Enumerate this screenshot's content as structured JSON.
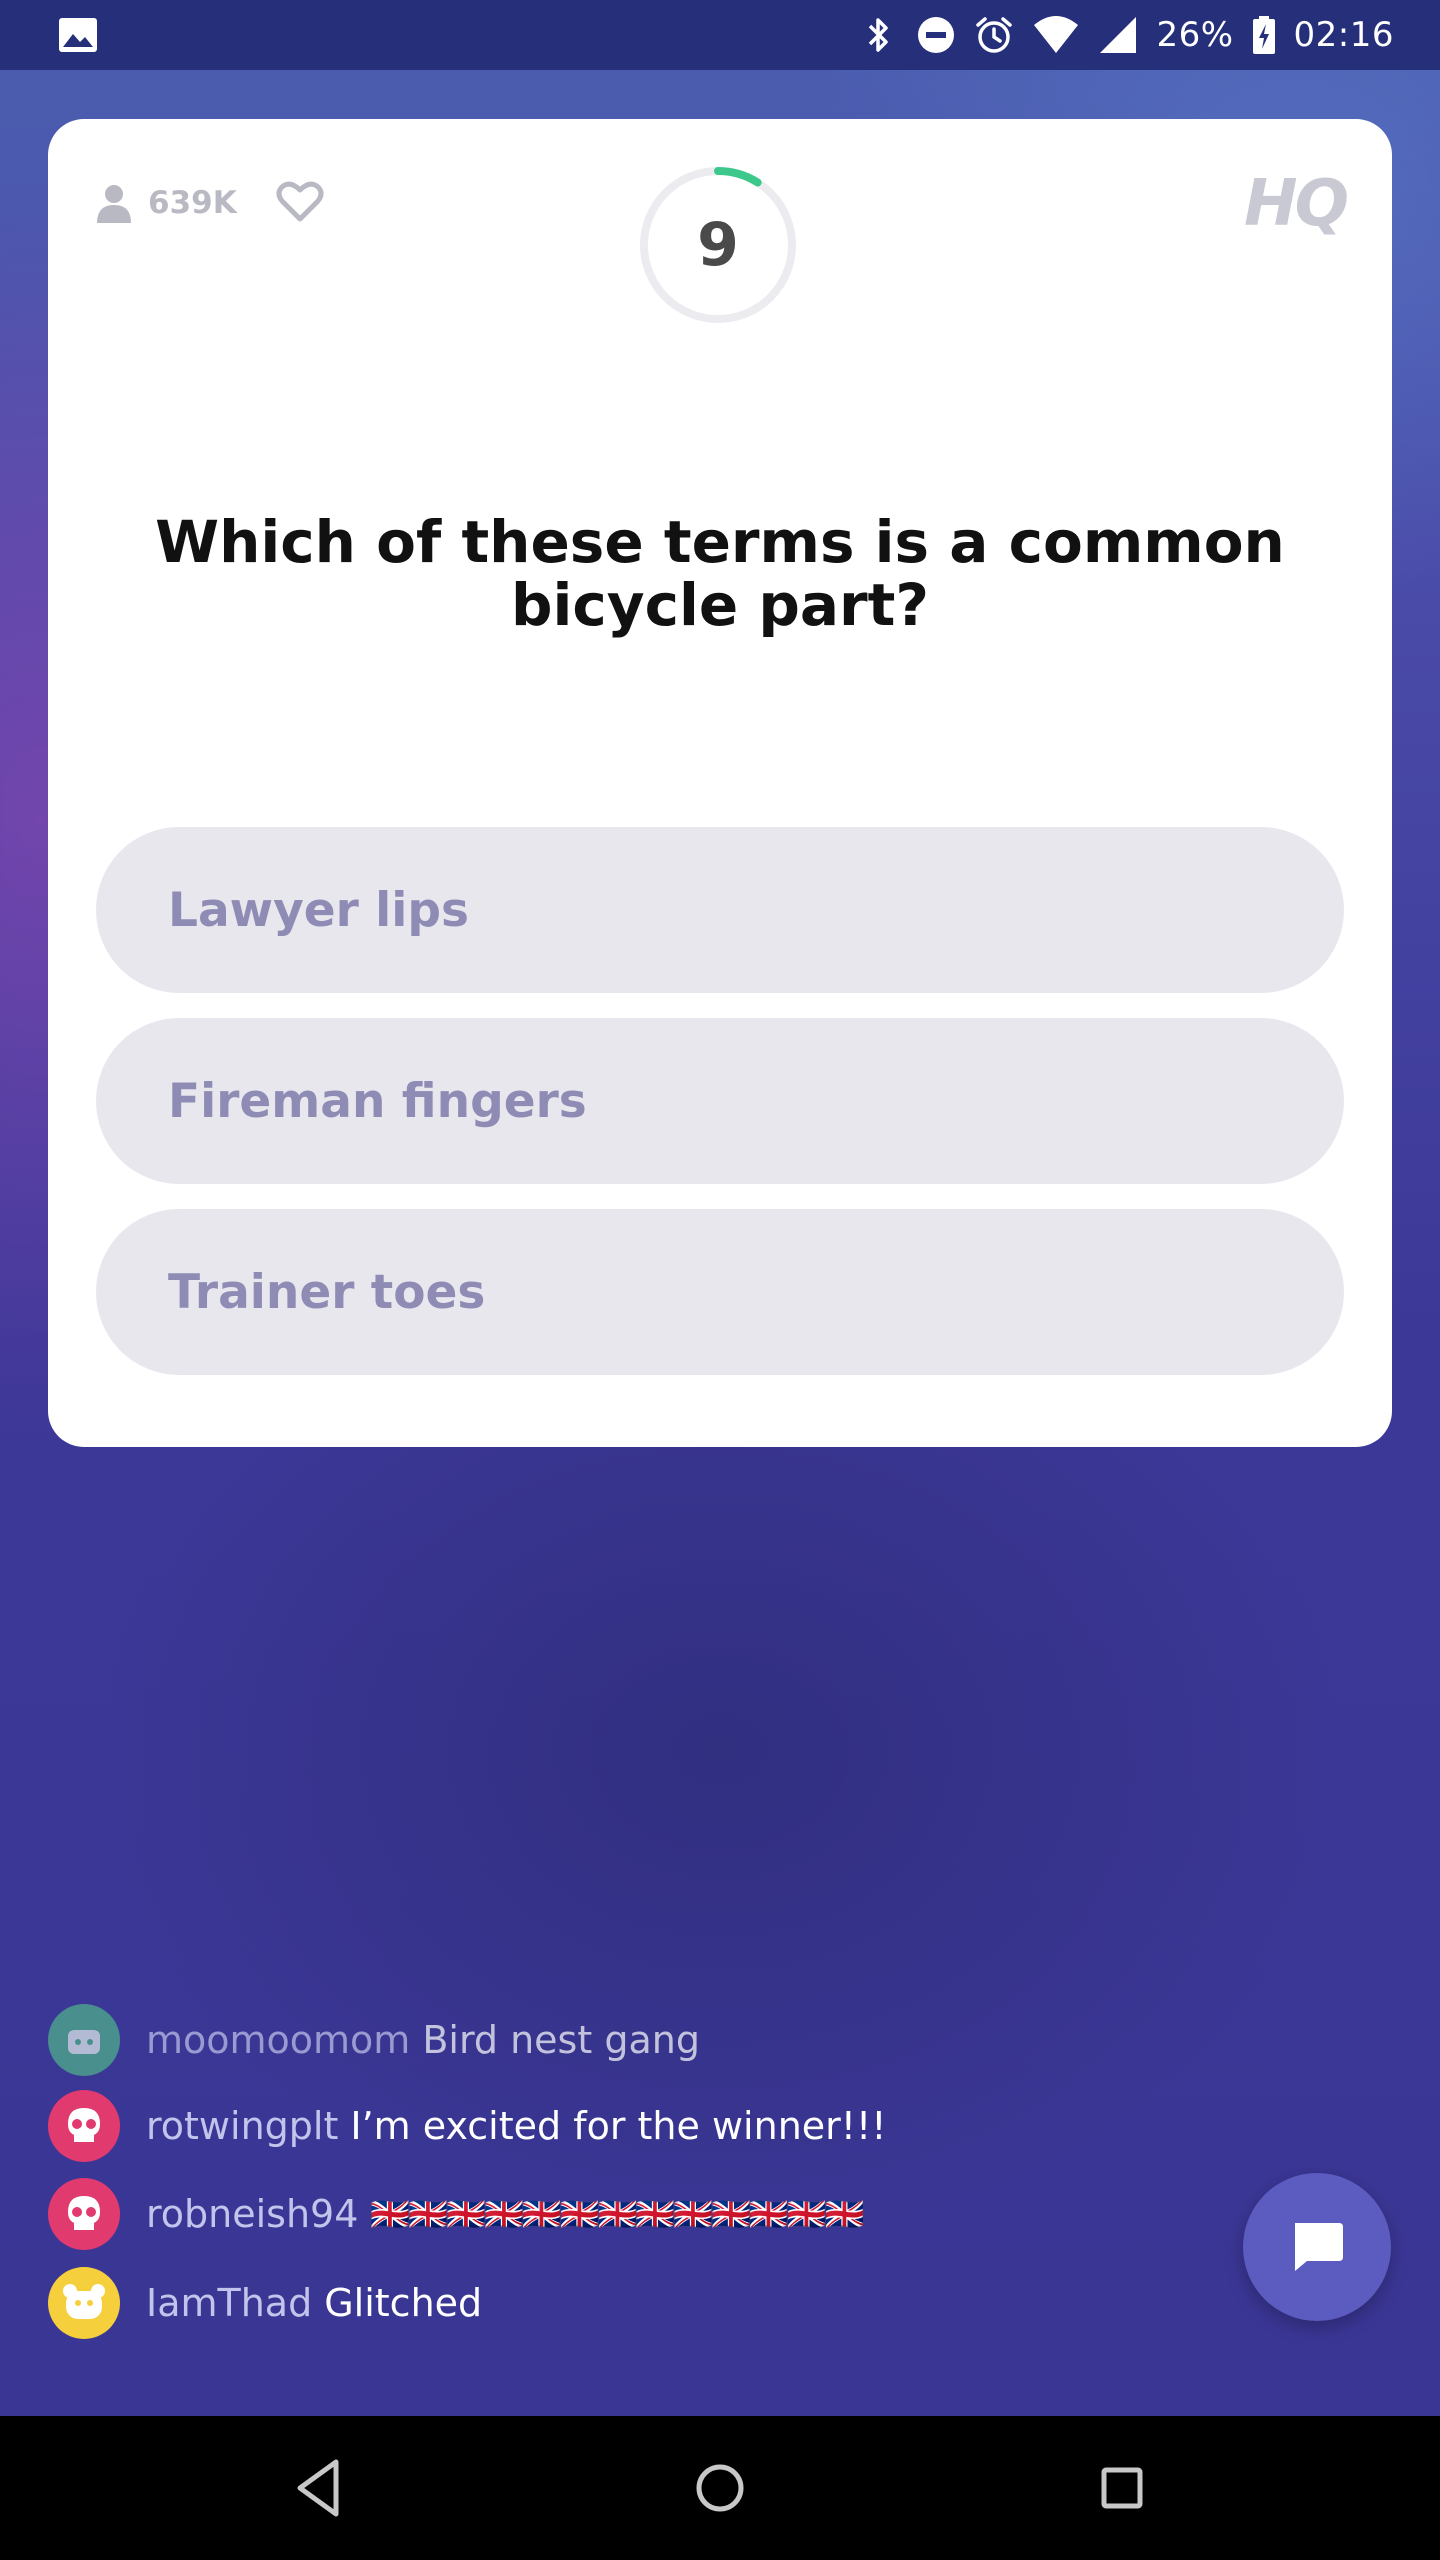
{
  "status_bar": {
    "battery_percent": "26%",
    "time": "02:16",
    "icons": [
      "image-icon",
      "bluetooth-icon",
      "do-not-disturb-icon",
      "alarm-icon",
      "wifi-icon",
      "cell-signal-icon",
      "battery-charging-icon"
    ]
  },
  "game": {
    "viewer_count": "639K",
    "timer_value": "9",
    "timer_fraction_remaining": 0.09,
    "logo": "HQ",
    "question": "Which of these terms is a common bicycle part?",
    "answers": [
      {
        "label": "Lawyer lips"
      },
      {
        "label": "Fireman fingers"
      },
      {
        "label": "Trainer toes"
      }
    ],
    "colors": {
      "timer_arc": "#3cc88a",
      "answer_bg": "#e8e7ee",
      "answer_text": "#8e8cb4"
    }
  },
  "chat": {
    "messages": [
      {
        "user": "moomoomom",
        "text": "Bird nest gang",
        "avatar_color": "#4fb58c"
      },
      {
        "user": "rotwingplt",
        "text": "I’m excited for the winner!!!",
        "avatar_color": "#e13a6e"
      },
      {
        "user": "robneish94",
        "text": "🇬🇧🇬🇧🇬🇧🇬🇧🇬🇧🇬🇧🇬🇧🇬🇧🇬🇧🇬🇧🇬🇧🇬🇧🇬🇧",
        "avatar_color": "#e13a6e"
      },
      {
        "user": "IamThad",
        "text": "Glitched",
        "avatar_color": "#f5cf3c"
      }
    ]
  }
}
